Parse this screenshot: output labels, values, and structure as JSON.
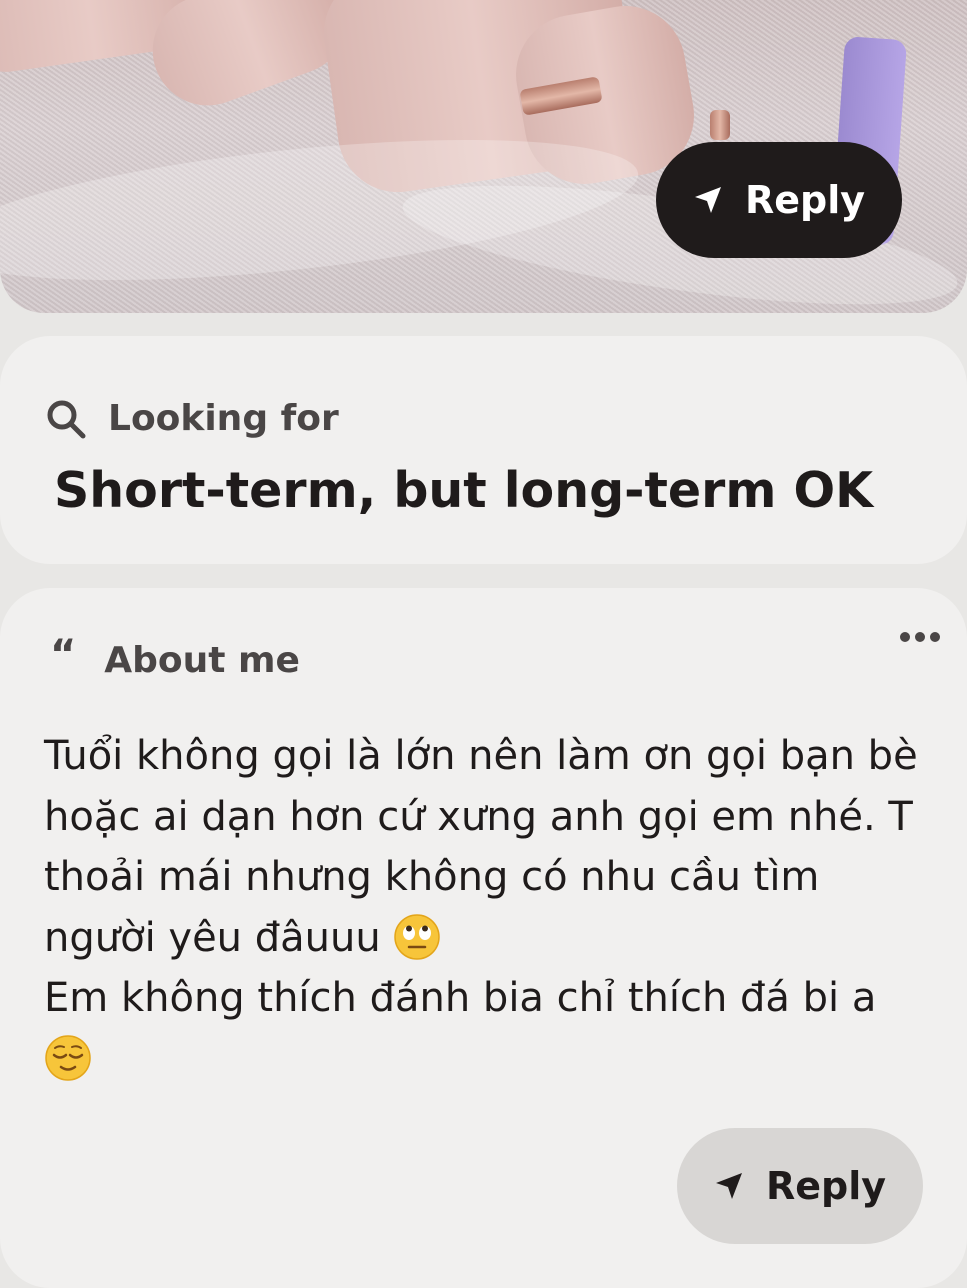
{
  "photo": {
    "reply_label": "Reply",
    "colors": {
      "background": "#cdbfc0",
      "nail_polish": "#b6a5e6"
    }
  },
  "looking_for": {
    "label": "Looking for",
    "value": "Short-term, but long-term OK",
    "icon": "search-icon"
  },
  "about_me": {
    "label": "About me",
    "icon": "quote-icon",
    "menu_icon": "more-icon",
    "bio_lines": [
      "Tuổi không gọi là lớn nên làm ơn gọi bạn bè hoặc ai dạn hơn cứ xưng anh gọi em nhé. T thoải mái nhưng không có nhu cầu tìm người yêu đâuuu",
      "Em không thích đánh bia chỉ thích đá bi a"
    ],
    "emojis": [
      "eye-roll-emoji",
      "relieved-emoji"
    ],
    "reply_label": "Reply"
  },
  "colors": {
    "page_bg": "#e8e7e5",
    "card_bg": "#f1f0ef",
    "dark_button": "#1f1b1b",
    "light_button": "#d8d6d4",
    "text": "#1f1b1b",
    "muted_text": "#4a4646"
  }
}
